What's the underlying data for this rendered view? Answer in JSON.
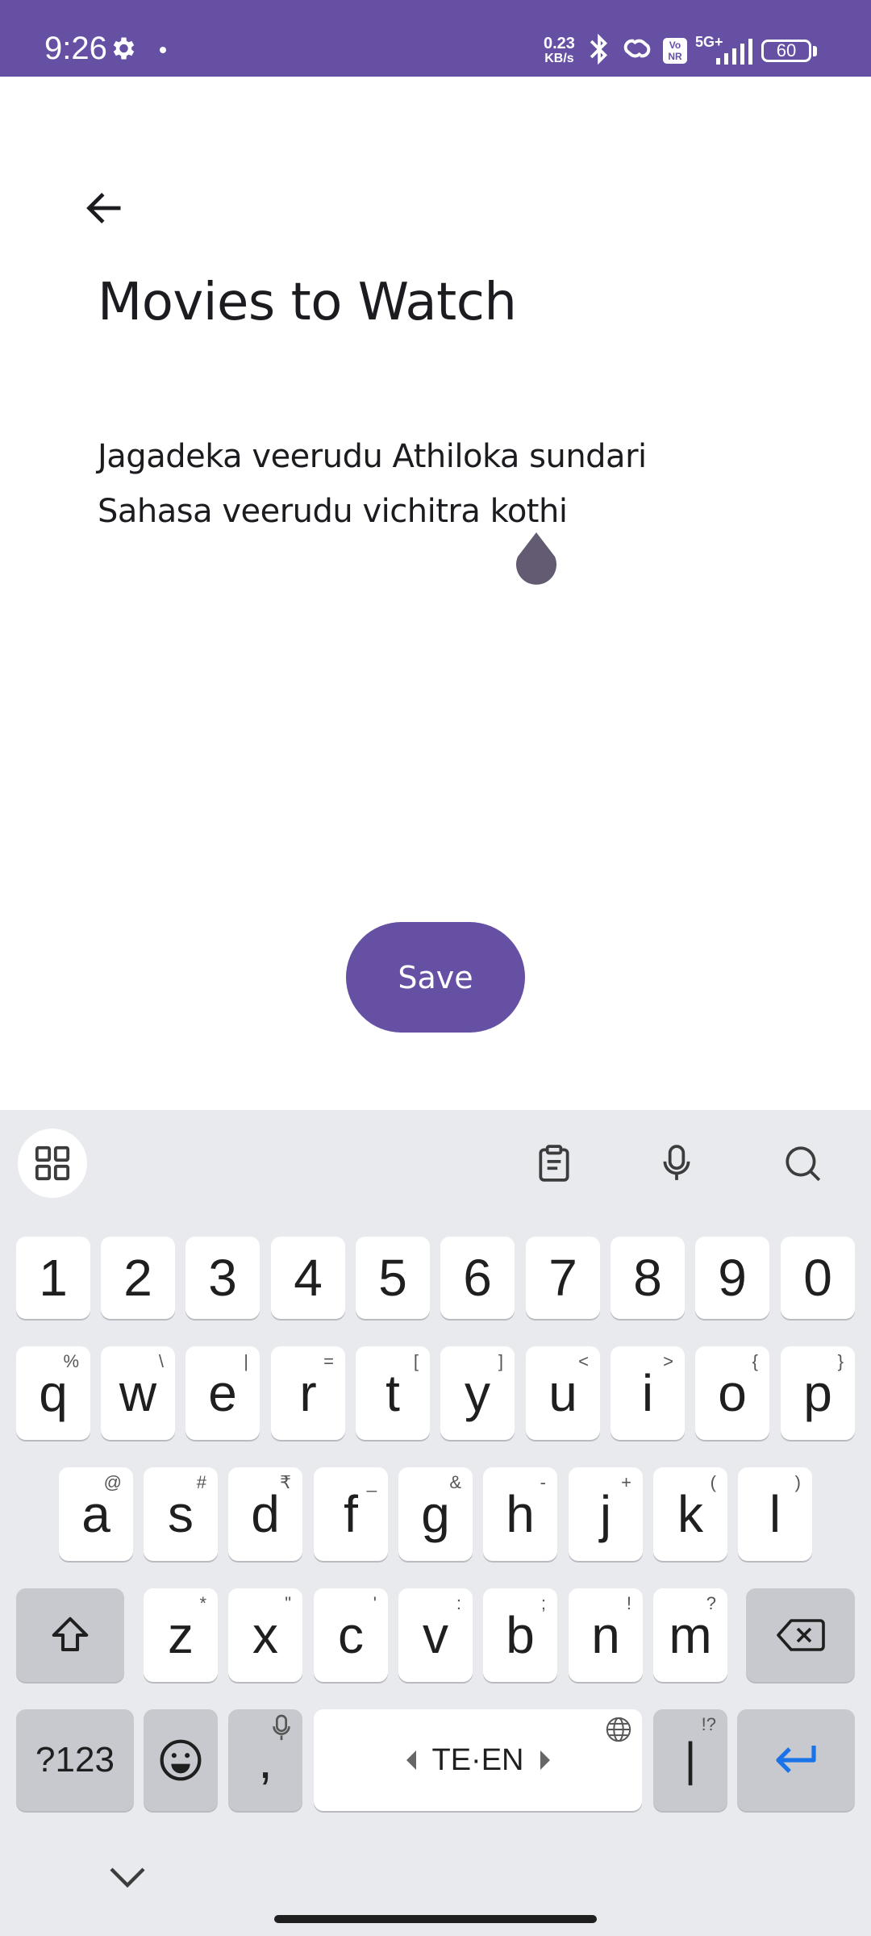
{
  "status_bar": {
    "time": "9:26",
    "speed_value": "0.23",
    "speed_unit": "KB/s",
    "volte_top": "Vo",
    "volte_bottom": "NR",
    "network": "5G+",
    "battery": "60",
    "battery_level_percent": 60
  },
  "note": {
    "title": "Movies to Watch",
    "lines": [
      "Jagadeka veerudu Athiloka sundari",
      "Sahasa veerudu vichitra kothi"
    ]
  },
  "actions": {
    "save_label": "Save"
  },
  "keyboard": {
    "number_row": [
      "1",
      "2",
      "3",
      "4",
      "5",
      "6",
      "7",
      "8",
      "9",
      "0"
    ],
    "row1": [
      {
        "key": "q",
        "hint": "%"
      },
      {
        "key": "w",
        "hint": "\\"
      },
      {
        "key": "e",
        "hint": "|"
      },
      {
        "key": "r",
        "hint": "="
      },
      {
        "key": "t",
        "hint": "["
      },
      {
        "key": "y",
        "hint": "]"
      },
      {
        "key": "u",
        "hint": "<"
      },
      {
        "key": "i",
        "hint": ">"
      },
      {
        "key": "o",
        "hint": "{"
      },
      {
        "key": "p",
        "hint": "}"
      }
    ],
    "row2": [
      {
        "key": "a",
        "hint": "@"
      },
      {
        "key": "s",
        "hint": "#"
      },
      {
        "key": "d",
        "hint": "₹"
      },
      {
        "key": "f",
        "hint": "_"
      },
      {
        "key": "g",
        "hint": "&"
      },
      {
        "key": "h",
        "hint": "-"
      },
      {
        "key": "j",
        "hint": "+"
      },
      {
        "key": "k",
        "hint": "("
      },
      {
        "key": "l",
        "hint": ")"
      }
    ],
    "row3": [
      {
        "key": "z",
        "hint": "*"
      },
      {
        "key": "x",
        "hint": "\""
      },
      {
        "key": "c",
        "hint": "'"
      },
      {
        "key": "v",
        "hint": ":"
      },
      {
        "key": "b",
        "hint": ";"
      },
      {
        "key": "n",
        "hint": "!"
      },
      {
        "key": "m",
        "hint": "?"
      }
    ],
    "symbols_label": "?123",
    "comma": ",",
    "space_label": "TE·EN",
    "period": "|",
    "period_hint": "!?",
    "accent_color": "#1a73e8"
  },
  "colors": {
    "primary": "#6650a4",
    "keyboard_bg": "#e9eaee",
    "key_bg": "#ffffff",
    "key_dark_bg": "#c7c9ce"
  },
  "icons": [
    "settings-gear-icon",
    "bluetooth-icon",
    "link-icon",
    "signal-icon",
    "battery-icon",
    "back-arrow-icon",
    "apps-grid-icon",
    "clipboard-icon",
    "microphone-icon",
    "search-icon",
    "shift-icon",
    "backspace-icon",
    "emoji-icon",
    "globe-icon",
    "enter-icon",
    "chevron-down-icon"
  ]
}
